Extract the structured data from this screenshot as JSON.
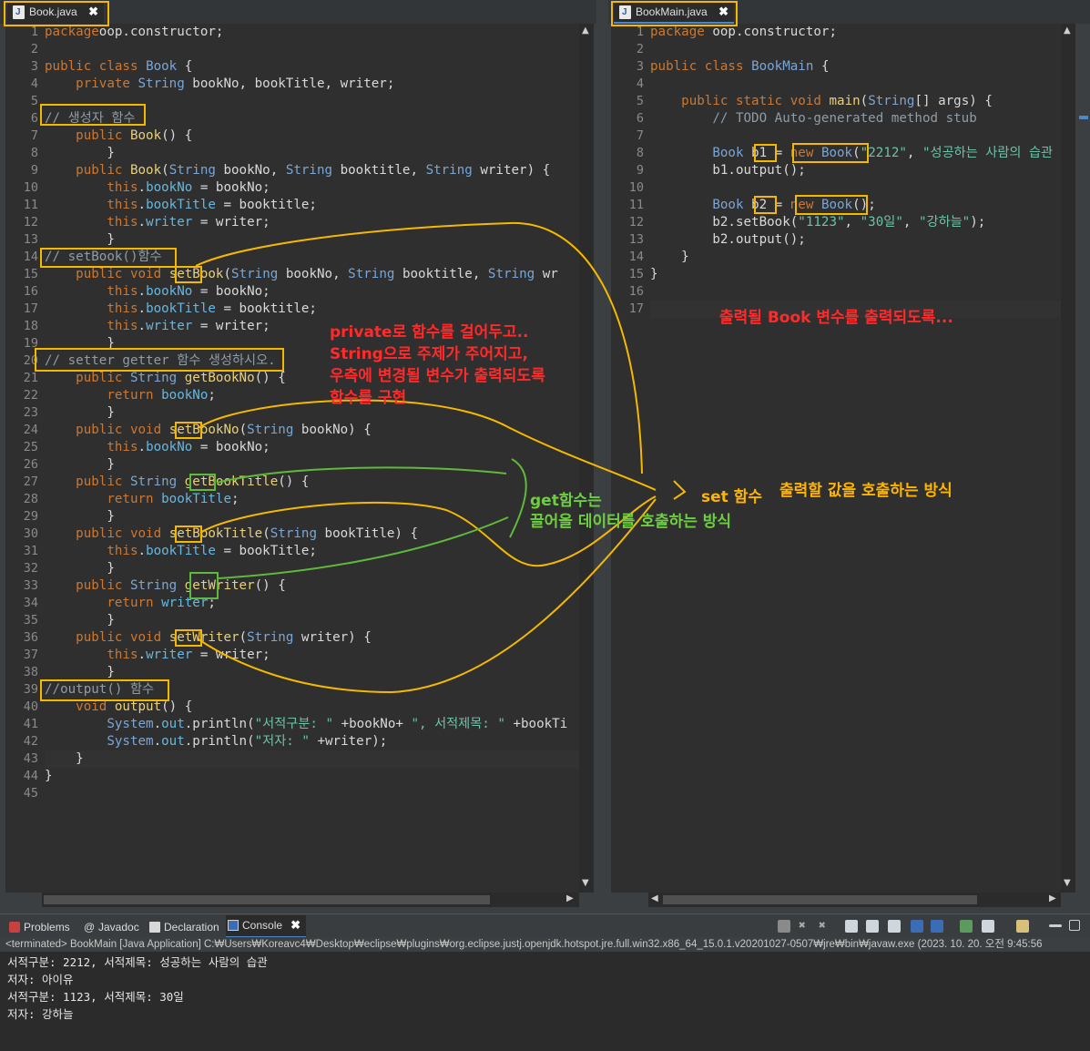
{
  "tabs": {
    "left": "Book.java",
    "right": "BookMain.java"
  },
  "book_java": [
    {
      "n": "1",
      "parts": [
        [
          "kw",
          "package"
        ],
        [
          "",
          "oop.constructor;"
        ]
      ]
    },
    {
      "n": "2",
      "parts": []
    },
    {
      "n": "3",
      "parts": [
        [
          "kw",
          "public"
        ],
        [
          "",
          " "
        ],
        [
          "kw",
          "class"
        ],
        [
          "",
          " "
        ],
        [
          "ty",
          "Book"
        ],
        [
          "",
          " {"
        ]
      ]
    },
    {
      "n": "4",
      "parts": [
        [
          "",
          "    "
        ],
        [
          "kw",
          "private"
        ],
        [
          "",
          " "
        ],
        [
          "ty",
          "String"
        ],
        [
          "",
          " bookNo, bookTitle, writer;"
        ]
      ]
    },
    {
      "n": "5",
      "parts": []
    },
    {
      "n": "6",
      "parts": [
        [
          "cm",
          "// 생성자 함수"
        ]
      ]
    },
    {
      "n": "7",
      "parts": [
        [
          "",
          "    "
        ],
        [
          "kw",
          "public"
        ],
        [
          "",
          " "
        ],
        [
          "mt",
          "Book"
        ],
        [
          "",
          "() {"
        ]
      ]
    },
    {
      "n": "8",
      "parts": [
        [
          "",
          "        }"
        ]
      ]
    },
    {
      "n": "9",
      "parts": [
        [
          "",
          "    "
        ],
        [
          "kw",
          "public"
        ],
        [
          "",
          " "
        ],
        [
          "mt",
          "Book"
        ],
        [
          "",
          "("
        ],
        [
          "ty",
          "String"
        ],
        [
          "",
          " bookNo, "
        ],
        [
          "ty",
          "String"
        ],
        [
          "",
          " booktitle, "
        ],
        [
          "ty",
          "String"
        ],
        [
          "",
          " writer) {"
        ]
      ]
    },
    {
      "n": "10",
      "parts": [
        [
          "",
          "        "
        ],
        [
          "kw",
          "this"
        ],
        [
          "",
          "."
        ],
        [
          "fd",
          "bookNo"
        ],
        [
          "",
          " = bookNo;"
        ]
      ]
    },
    {
      "n": "11",
      "parts": [
        [
          "",
          "        "
        ],
        [
          "kw",
          "this"
        ],
        [
          "",
          "."
        ],
        [
          "fd",
          "bookTitle"
        ],
        [
          "",
          " = booktitle;"
        ]
      ]
    },
    {
      "n": "12",
      "parts": [
        [
          "",
          "        "
        ],
        [
          "kw",
          "this"
        ],
        [
          "",
          "."
        ],
        [
          "fd",
          "writer"
        ],
        [
          "",
          " = writer;"
        ]
      ]
    },
    {
      "n": "13",
      "parts": [
        [
          "",
          "        }"
        ]
      ]
    },
    {
      "n": "14",
      "parts": [
        [
          "cm",
          "// setBook()함수"
        ]
      ]
    },
    {
      "n": "15",
      "parts": [
        [
          "",
          "    "
        ],
        [
          "kw",
          "public"
        ],
        [
          "",
          " "
        ],
        [
          "kw",
          "void"
        ],
        [
          "",
          " "
        ],
        [
          "mt",
          "setBook"
        ],
        [
          "",
          "("
        ],
        [
          "ty",
          "String"
        ],
        [
          "",
          " bookNo, "
        ],
        [
          "ty",
          "String"
        ],
        [
          "",
          " booktitle, "
        ],
        [
          "ty",
          "String"
        ],
        [
          "",
          " wr"
        ]
      ]
    },
    {
      "n": "16",
      "parts": [
        [
          "",
          "        "
        ],
        [
          "kw",
          "this"
        ],
        [
          "",
          "."
        ],
        [
          "fd",
          "bookNo"
        ],
        [
          "",
          " = bookNo;"
        ]
      ]
    },
    {
      "n": "17",
      "parts": [
        [
          "",
          "        "
        ],
        [
          "kw",
          "this"
        ],
        [
          "",
          "."
        ],
        [
          "fd",
          "bookTitle"
        ],
        [
          "",
          " = booktitle;"
        ]
      ]
    },
    {
      "n": "18",
      "parts": [
        [
          "",
          "        "
        ],
        [
          "kw",
          "this"
        ],
        [
          "",
          "."
        ],
        [
          "fd",
          "writer"
        ],
        [
          "",
          " = writer;"
        ]
      ]
    },
    {
      "n": "19",
      "parts": [
        [
          "",
          "        }"
        ]
      ]
    },
    {
      "n": "20",
      "parts": [
        [
          "cm",
          "// setter getter 함수 생성하시오."
        ]
      ]
    },
    {
      "n": "21",
      "parts": [
        [
          "",
          "    "
        ],
        [
          "kw",
          "public"
        ],
        [
          "",
          " "
        ],
        [
          "ty",
          "String"
        ],
        [
          "",
          " "
        ],
        [
          "mt",
          "getBookNo"
        ],
        [
          "",
          "() {"
        ]
      ]
    },
    {
      "n": "22",
      "parts": [
        [
          "",
          "        "
        ],
        [
          "kw",
          "return"
        ],
        [
          "",
          " "
        ],
        [
          "fd",
          "bookNo"
        ],
        [
          "",
          ";"
        ]
      ]
    },
    {
      "n": "23",
      "parts": [
        [
          "",
          "        }"
        ]
      ]
    },
    {
      "n": "24",
      "parts": [
        [
          "",
          "    "
        ],
        [
          "kw",
          "public"
        ],
        [
          "",
          " "
        ],
        [
          "kw",
          "void"
        ],
        [
          "",
          " "
        ],
        [
          "mt",
          "setBookNo"
        ],
        [
          "",
          "("
        ],
        [
          "ty",
          "String"
        ],
        [
          "",
          " bookNo) {"
        ]
      ]
    },
    {
      "n": "25",
      "parts": [
        [
          "",
          "        "
        ],
        [
          "kw",
          "this"
        ],
        [
          "",
          "."
        ],
        [
          "fd",
          "bookNo"
        ],
        [
          "",
          " = bookNo;"
        ]
      ]
    },
    {
      "n": "26",
      "parts": [
        [
          "",
          "        }"
        ]
      ]
    },
    {
      "n": "27",
      "parts": [
        [
          "",
          "    "
        ],
        [
          "kw",
          "public"
        ],
        [
          "",
          " "
        ],
        [
          "ty",
          "String"
        ],
        [
          "",
          " "
        ],
        [
          "mt",
          "getBookTitle"
        ],
        [
          "",
          "() {"
        ]
      ]
    },
    {
      "n": "28",
      "parts": [
        [
          "",
          "        "
        ],
        [
          "kw",
          "return"
        ],
        [
          "",
          " "
        ],
        [
          "fd",
          "bookTitle"
        ],
        [
          "",
          ";"
        ]
      ]
    },
    {
      "n": "29",
      "parts": [
        [
          "",
          "        }"
        ]
      ]
    },
    {
      "n": "30",
      "parts": [
        [
          "",
          "    "
        ],
        [
          "kw",
          "public"
        ],
        [
          "",
          " "
        ],
        [
          "kw",
          "void"
        ],
        [
          "",
          " "
        ],
        [
          "mt",
          "setBookTitle"
        ],
        [
          "",
          "("
        ],
        [
          "ty",
          "String"
        ],
        [
          "",
          " bookTitle) {"
        ]
      ]
    },
    {
      "n": "31",
      "parts": [
        [
          "",
          "        "
        ],
        [
          "kw",
          "this"
        ],
        [
          "",
          "."
        ],
        [
          "fd",
          "bookTitle"
        ],
        [
          "",
          " = bookTitle;"
        ]
      ]
    },
    {
      "n": "32",
      "parts": [
        [
          "",
          "        }"
        ]
      ]
    },
    {
      "n": "33",
      "parts": [
        [
          "",
          "    "
        ],
        [
          "kw",
          "public"
        ],
        [
          "",
          " "
        ],
        [
          "ty",
          "String"
        ],
        [
          "",
          " "
        ],
        [
          "mt",
          "getWriter"
        ],
        [
          "",
          "() {"
        ]
      ]
    },
    {
      "n": "34",
      "parts": [
        [
          "",
          "        "
        ],
        [
          "kw",
          "return"
        ],
        [
          "",
          " "
        ],
        [
          "fd",
          "writer"
        ],
        [
          "",
          ";"
        ]
      ]
    },
    {
      "n": "35",
      "parts": [
        [
          "",
          "        }"
        ]
      ]
    },
    {
      "n": "36",
      "parts": [
        [
          "",
          "    "
        ],
        [
          "kw",
          "public"
        ],
        [
          "",
          " "
        ],
        [
          "kw",
          "void"
        ],
        [
          "",
          " "
        ],
        [
          "mt",
          "setWriter"
        ],
        [
          "",
          "("
        ],
        [
          "ty",
          "String"
        ],
        [
          "",
          " writer) {"
        ]
      ]
    },
    {
      "n": "37",
      "parts": [
        [
          "",
          "        "
        ],
        [
          "kw",
          "this"
        ],
        [
          "",
          "."
        ],
        [
          "fd",
          "writer"
        ],
        [
          "",
          " = writer;"
        ]
      ]
    },
    {
      "n": "38",
      "parts": [
        [
          "",
          "        }"
        ]
      ]
    },
    {
      "n": "39",
      "parts": [
        [
          "cm",
          "//output() 함수"
        ]
      ]
    },
    {
      "n": "40",
      "parts": [
        [
          "",
          "    "
        ],
        [
          "kw",
          "void"
        ],
        [
          "",
          " "
        ],
        [
          "mt",
          "output"
        ],
        [
          "",
          "() {"
        ]
      ]
    },
    {
      "n": "41",
      "parts": [
        [
          "",
          "        "
        ],
        [
          "ty",
          "System"
        ],
        [
          "",
          "."
        ],
        [
          "fd",
          "out"
        ],
        [
          "",
          ".println("
        ],
        [
          "st",
          "\"서적구분: \""
        ],
        [
          "",
          " +bookNo+ "
        ],
        [
          "st",
          "\", 서적제목: \""
        ],
        [
          "",
          " +bookTi"
        ]
      ]
    },
    {
      "n": "42",
      "parts": [
        [
          "",
          "        "
        ],
        [
          "ty",
          "System"
        ],
        [
          "",
          "."
        ],
        [
          "fd",
          "out"
        ],
        [
          "",
          ".println("
        ],
        [
          "st",
          "\"저자: \""
        ],
        [
          "",
          " +writer);"
        ]
      ]
    },
    {
      "n": "43",
      "parts": [
        [
          "",
          "    }"
        ]
      ],
      "hl": true
    },
    {
      "n": "44",
      "parts": [
        [
          "",
          "}"
        ]
      ]
    },
    {
      "n": "45",
      "parts": []
    }
  ],
  "bookmain_java": [
    {
      "n": "1",
      "parts": [
        [
          "kw",
          "package"
        ],
        [
          "",
          " oop.constructor;"
        ]
      ]
    },
    {
      "n": "2",
      "parts": []
    },
    {
      "n": "3",
      "parts": [
        [
          "kw",
          "public"
        ],
        [
          "",
          " "
        ],
        [
          "kw",
          "class"
        ],
        [
          "",
          " "
        ],
        [
          "ty",
          "BookMain"
        ],
        [
          "",
          " {"
        ]
      ]
    },
    {
      "n": "4",
      "parts": []
    },
    {
      "n": "5",
      "parts": [
        [
          "",
          "    "
        ],
        [
          "kw",
          "public"
        ],
        [
          "",
          " "
        ],
        [
          "kw",
          "static"
        ],
        [
          "",
          " "
        ],
        [
          "kw",
          "void"
        ],
        [
          "",
          " "
        ],
        [
          "mt",
          "main"
        ],
        [
          "",
          "("
        ],
        [
          "ty",
          "String"
        ],
        [
          "",
          "[] args) {"
        ]
      ]
    },
    {
      "n": "6",
      "parts": [
        [
          "",
          "        "
        ],
        [
          "cm",
          "// TODO Auto-generated method stub"
        ]
      ]
    },
    {
      "n": "7",
      "parts": []
    },
    {
      "n": "8",
      "parts": [
        [
          "",
          "        "
        ],
        [
          "ty",
          "Book"
        ],
        [
          "",
          " b1 = "
        ],
        [
          "kw",
          "new"
        ],
        [
          "",
          " "
        ],
        [
          "ty",
          "Book"
        ],
        [
          "",
          "("
        ],
        [
          "st",
          "\"2212\""
        ],
        [
          "",
          ", "
        ],
        [
          "st",
          "\"성공하는 사람의 습관"
        ]
      ]
    },
    {
      "n": "9",
      "parts": [
        [
          "",
          "        b1.output();"
        ]
      ]
    },
    {
      "n": "10",
      "parts": []
    },
    {
      "n": "11",
      "parts": [
        [
          "",
          "        "
        ],
        [
          "ty",
          "Book"
        ],
        [
          "",
          " b2 = "
        ],
        [
          "kw",
          "new"
        ],
        [
          "",
          " "
        ],
        [
          "ty",
          "Book"
        ],
        [
          "",
          "();"
        ]
      ]
    },
    {
      "n": "12",
      "parts": [
        [
          "",
          "        b2.setBook("
        ],
        [
          "st",
          "\"1123\""
        ],
        [
          "",
          ", "
        ],
        [
          "st",
          "\"30일\""
        ],
        [
          "",
          ", "
        ],
        [
          "st",
          "\"강하늘\""
        ],
        [
          "",
          ");"
        ]
      ]
    },
    {
      "n": "13",
      "parts": [
        [
          "",
          "        b2.output();"
        ]
      ]
    },
    {
      "n": "14",
      "parts": [
        [
          "",
          "    }"
        ]
      ]
    },
    {
      "n": "15",
      "parts": [
        [
          "",
          "}"
        ]
      ]
    },
    {
      "n": "16",
      "parts": []
    },
    {
      "n": "17",
      "parts": [],
      "hl": true
    }
  ],
  "console_tabs": {
    "problems": "Problems",
    "javadoc": "Javadoc",
    "declaration": "Declaration",
    "console": "Console"
  },
  "console_header": "<terminated> BookMain [Java Application] C:₩Users₩Koreavc4₩Desktop₩eclipse₩plugins₩org.eclipse.justj.openjdk.hotspot.jre.full.win32.x86_64_15.0.1.v20201027-0507₩jre₩bin₩javaw.exe  (2023. 10. 20. 오전 9:45:56",
  "console_output": [
    "서적구분: 2212, 서적제목: 성공하는 사람의 습관",
    "저자: 아이유",
    "서적구분: 1123, 서적제목: 30일",
    "저자: 강하늘"
  ],
  "annotations": {
    "private_note_1": "private로 함수를 걸어두고..",
    "private_note_2": "String으로 주제가 주어지고,",
    "private_note_3": "우측에 변경될 변수가 출력되도록",
    "private_note_4": "함수를 구현",
    "get_note_1": "get함수는",
    "get_note_2": "끌어올 데이터를 호출하는 방식",
    "set_label": "set 함수",
    "set_note": "출력할 값을 호출하는 방식",
    "output_note": "출력될 Book 변수를 출력되도록..."
  },
  "colors": {
    "highlight_box": "#f5b800",
    "green_box": "#5fba3c",
    "red_text": "#ff2a2a",
    "yellow_text": "#ffb400"
  }
}
